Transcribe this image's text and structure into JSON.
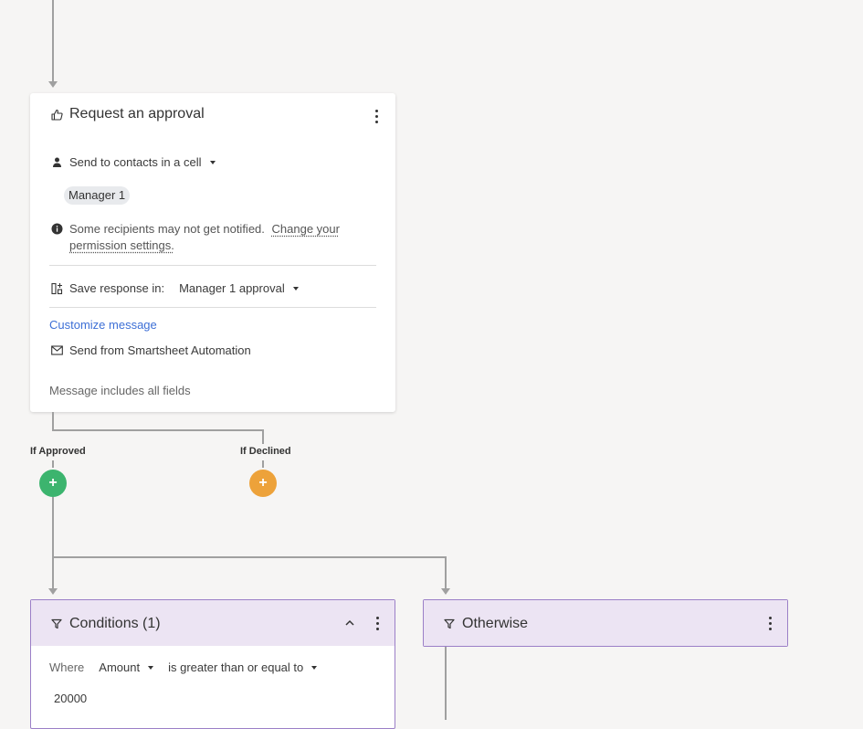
{
  "approval_card": {
    "title": "Request an approval",
    "recipient_mode": "Send to contacts in a cell",
    "recipient_chip": "Manager 1",
    "notice_text": "Some recipients may not get notified.",
    "notice_link_line1": "Change your",
    "notice_link_line2": "permission settings.",
    "save_response_label": "Save response in:",
    "save_response_value": "Manager 1 approval",
    "customize_link": "Customize message",
    "send_from": "Send from Smartsheet Automation",
    "message_note": "Message includes all fields"
  },
  "branches": {
    "approved_label": "If Approved",
    "declined_label": "If Declined",
    "add_symbol": "+",
    "approved_color": "#3cb46e",
    "declined_color": "#eda23a"
  },
  "conditions_card": {
    "title": "Conditions (1)",
    "where_label": "Where",
    "field": "Amount",
    "operator": "is greater than or equal to",
    "value": "20000"
  },
  "otherwise_card": {
    "title": "Otherwise"
  },
  "colors": {
    "accent_link": "#3d6fd6",
    "condition_border": "#9b7fc7",
    "condition_header": "#ece4f3"
  }
}
